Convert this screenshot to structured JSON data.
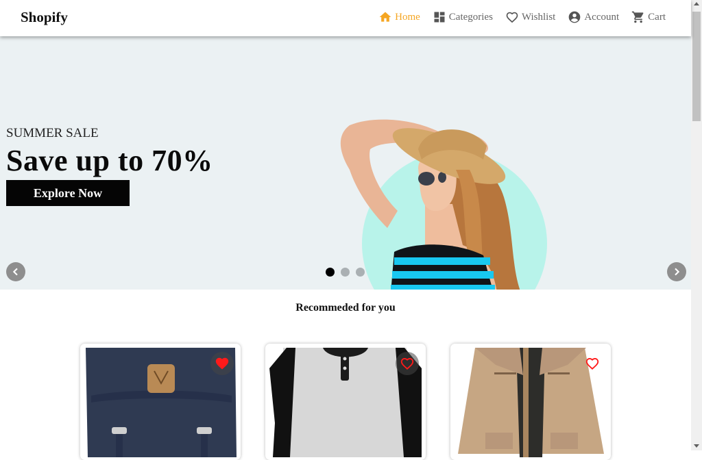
{
  "navbar": {
    "brand": "Shopify",
    "items": [
      {
        "label": "Home",
        "icon": "home-icon",
        "active": true
      },
      {
        "label": "Categories",
        "icon": "grid-icon",
        "active": false
      },
      {
        "label": "Wishlist",
        "icon": "heart-outline-icon",
        "active": false
      },
      {
        "label": "Account",
        "icon": "account-circle-icon",
        "active": false
      },
      {
        "label": "Cart",
        "icon": "cart-icon",
        "active": false
      }
    ],
    "active_color": "#f5a623",
    "inactive_color": "#666666"
  },
  "hero": {
    "subtitle": "SUMMER SALE",
    "title": "Save up to 70%",
    "cta_label": "Explore Now",
    "background": "#ebf1f3",
    "accent_circle": "#b8f3ea",
    "slides_total": 3,
    "active_slide": 1
  },
  "recommended": {
    "title": "Recommeded for you",
    "products": [
      {
        "name": "backpack",
        "wishlisted": true
      },
      {
        "name": "henley-shirt",
        "wishlisted": false
      },
      {
        "name": "khaki-jacket",
        "wishlisted": false
      }
    ],
    "heart_color": "#ff1a1a"
  }
}
